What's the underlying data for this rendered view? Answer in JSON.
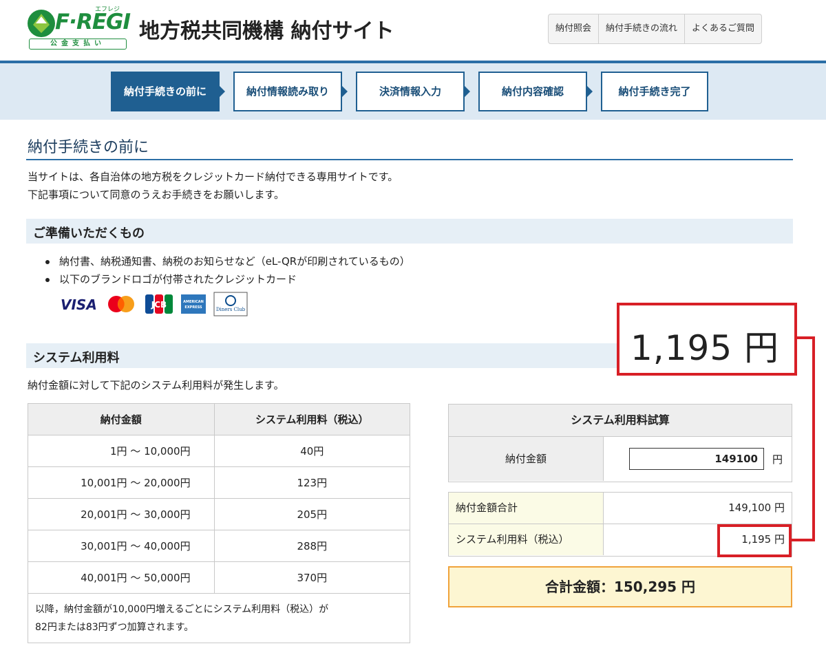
{
  "header": {
    "logo_text": "F·REGI",
    "logo_ruby": "エフレジ",
    "logo_sub": "公金支払い",
    "site_title": "地方税共同機構 納付サイト",
    "nav": [
      "納付照会",
      "納付手続きの流れ",
      "よくあるご質問"
    ]
  },
  "steps": [
    "納付手続きの前に",
    "納付情報読み取り",
    "決済情報入力",
    "納付内容確認",
    "納付手続き完了"
  ],
  "page": {
    "heading": "納付手続きの前に",
    "intro_1": "当サイトは、各自治体の地方税をクレジットカード納付できる専用サイトです。",
    "intro_2": "下記事項について同意のうえお手続きをお願いします。"
  },
  "prepare": {
    "title": "ご準備いただくもの",
    "items": [
      "納付書、納税通知書、納税のお知らせなど（eL-QRが印刷されているもの）",
      "以下のブランドロゴが付帯されたクレジットカード"
    ],
    "card_brands": [
      "VISA",
      "Mastercard",
      "JCB",
      "American Express",
      "Diners Club"
    ],
    "visa_label": "VISA",
    "jcb_label": "JCB",
    "amex_label": "AMERICAN EXPRESS",
    "diners_label": "Diners Club"
  },
  "system_fee": {
    "title": "システム利用料",
    "note": "納付金額に対して下記のシステム利用料が発生します。",
    "headers": [
      "納付金額",
      "システム利用料（税込）"
    ],
    "rows": [
      {
        "range": "1円 ～ 10,000円",
        "fee": "40円"
      },
      {
        "range": "10,001円 ～ 20,000円",
        "fee": "123円"
      },
      {
        "range": "20,001円 ～ 30,000円",
        "fee": "205円"
      },
      {
        "range": "30,001円 ～ 40,000円",
        "fee": "288円"
      },
      {
        "range": "40,001円 ～ 50,000円",
        "fee": "370円"
      }
    ],
    "footnote_1": "以降，納付金額が10,000円増えるごとにシステム利用料（税込）が",
    "footnote_2": "82円または83円ずつ加算されます。"
  },
  "calculator": {
    "title": "システム利用料試算",
    "amount_label": "納付金額",
    "amount_value": "149100",
    "unit": "円",
    "total_label": "納付金額合計",
    "total_value": "149,100 円",
    "fee_label": "システム利用料（税込）",
    "fee_value": "1,195 円",
    "grand_total": "合計金額：150,295 円"
  },
  "annotation": {
    "callout_text": "1,195 円",
    "color": "#d81f26"
  },
  "colors": {
    "brand_green": "#1e8e3e",
    "brand_blue": "#1f5f91",
    "accent_orange": "#f0a23a"
  }
}
